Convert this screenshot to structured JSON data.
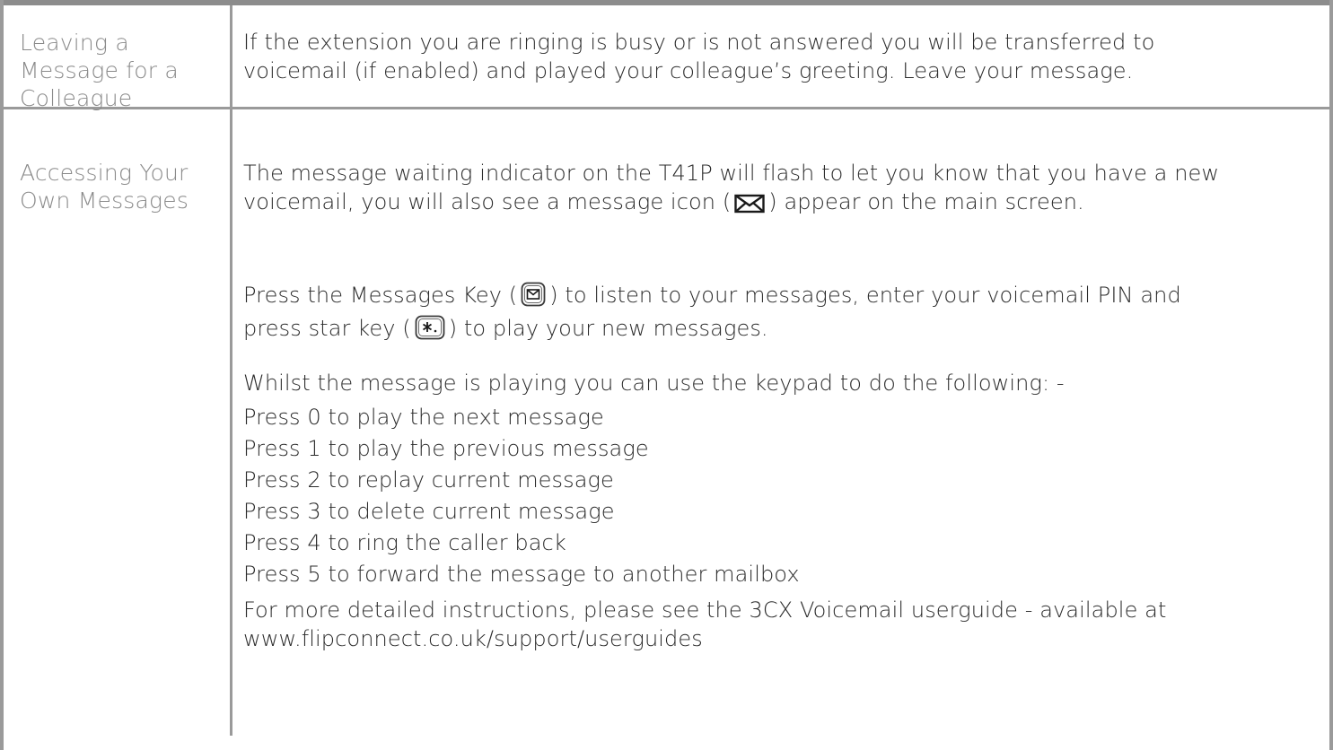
{
  "rows": [
    {
      "label_lines": [
        "Leaving a",
        "Message for a",
        "Colleague"
      ],
      "text_lines": [
        "If the extension you are ringing is busy or is not answered you will be transferred to",
        "voicemail (if enabled) and played your colleague’s greeting. Leave your message."
      ]
    },
    {
      "label_lines": [
        "Accessing Your",
        "Own Messages"
      ],
      "indicator_lines": {
        "line1": "The message waiting indicator on the T41P will flash to let you know that you have a new",
        "line2_before": "voicemail, you will also see a message icon (",
        "line2_after": ") appear on the main screen."
      },
      "messages_key_lines": {
        "line1_before": "Press the Messages Key (",
        "line1_after": ") to listen to your messages, enter your voicemail PIN and",
        "line2_before": "press star key (",
        "line2_after": ") to play your new messages."
      },
      "keypad_intro": "Whilst the message is playing you can use the keypad to do the following: -",
      "keypad_options": [
        "Press 0 to play the next message",
        "Press 1 to play the previous message",
        "Press 2 to replay current message",
        "Press 3 to delete current message",
        "Press 4 to ring the caller back",
        "Press 5 to forward the message to another mailbox"
      ],
      "more_info_lines": [
        "For more detailed instructions, please see the 3CX Voicemail userguide - available at",
        "www.flipconnect.co.uk/support/userguides"
      ]
    }
  ],
  "icons": {
    "envelope": "envelope-icon",
    "messages_key": "messages-key-icon",
    "star_key": "star-key-icon"
  },
  "colors": {
    "border": "#9a9a9a",
    "label_text": "#8a8a8a",
    "body_text": "#2b2b2b"
  }
}
